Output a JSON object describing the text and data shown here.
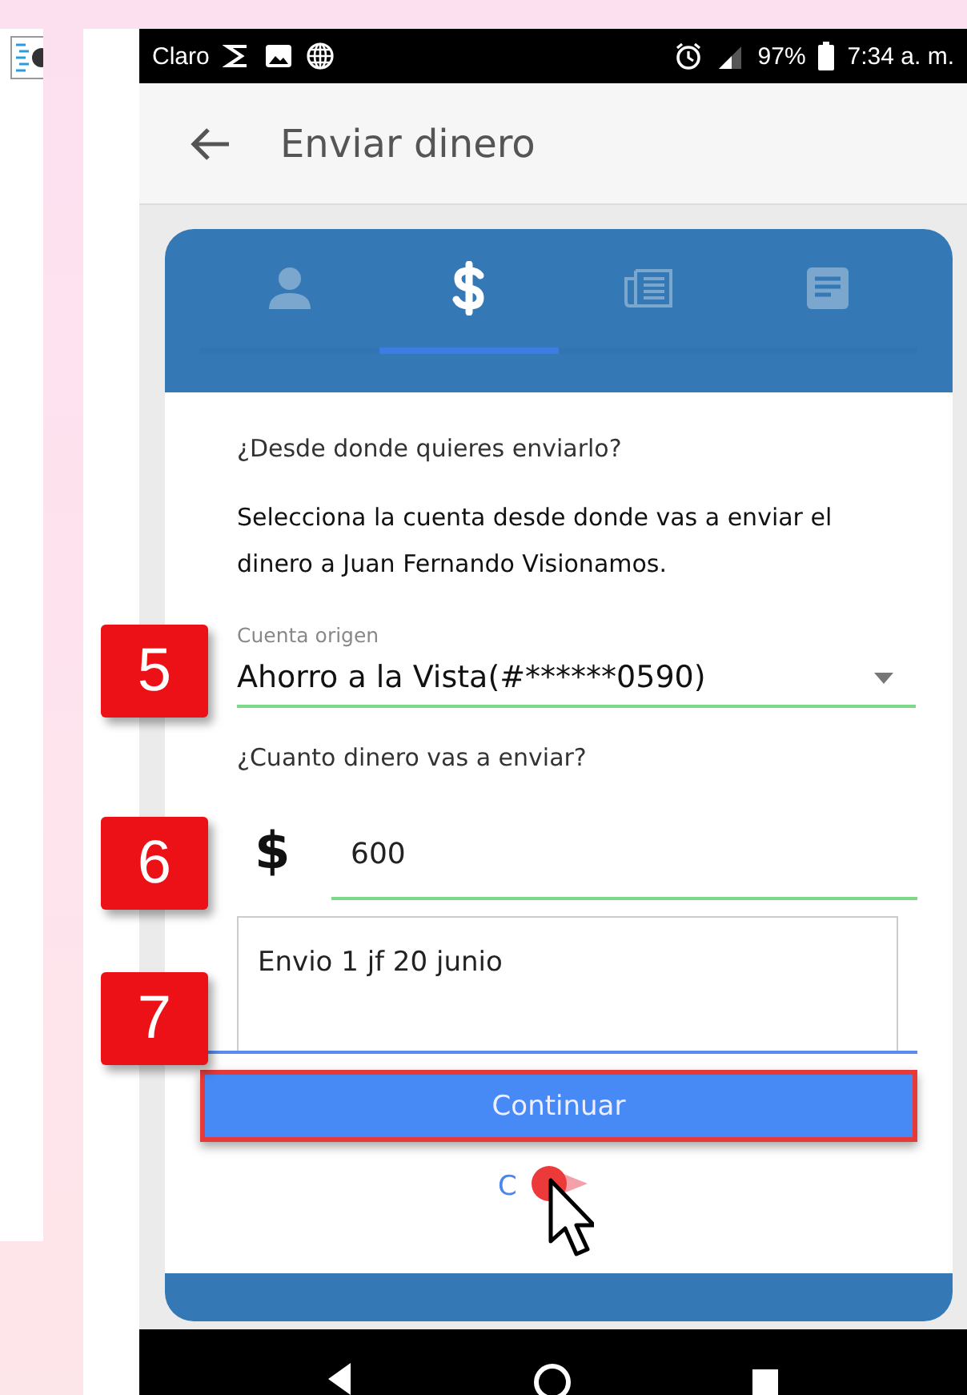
{
  "status_bar": {
    "carrier": "Claro",
    "battery": "97%",
    "time": "7:34 a. m."
  },
  "app_bar": {
    "title": "Enviar dinero"
  },
  "tabs": [
    {
      "kind": "person",
      "selected": false
    },
    {
      "kind": "dollar",
      "selected": true
    },
    {
      "kind": "newspaper",
      "selected": false
    },
    {
      "kind": "notes",
      "selected": false
    }
  ],
  "form": {
    "question_source": "¿Desde donde quieres enviarlo?",
    "instruction": "Selecciona la cuenta desde donde vas a enviar el dinero a Juan Fernando Visionamos.",
    "account_label": "Cuenta origen",
    "account_value": "Ahorro a la Vista(#******0590)",
    "question_amount": "¿Cuanto dinero vas a enviar?",
    "currency": "$",
    "amount": "600",
    "note": "Envio 1 jf 20 junio",
    "continue_button": "Continuar",
    "link": "C"
  },
  "callouts": [
    {
      "kind": "account",
      "label": "5"
    },
    {
      "kind": "amount",
      "label": "6"
    },
    {
      "kind": "note",
      "label": "7"
    }
  ]
}
